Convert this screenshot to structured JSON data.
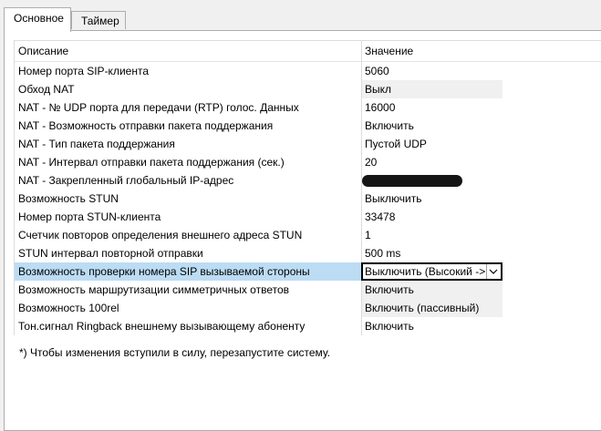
{
  "tabs": [
    {
      "label": "Основное",
      "active": true
    },
    {
      "label": "Таймер",
      "active": false
    }
  ],
  "table": {
    "header": {
      "description": "Описание",
      "value": "Значение"
    },
    "rows": [
      {
        "description": "Номер порта SIP-клиента",
        "value": "5060"
      },
      {
        "description": "Обход NAT",
        "value": "Выкл"
      },
      {
        "description": "NAT - № UDP порта для передачи (RTP) голос. Данных",
        "value": "16000"
      },
      {
        "description": "NAT - Возможность отправки пакета поддержания",
        "value": "Включить"
      },
      {
        "description": "NAT - Тип пакета поддержания",
        "value": "Пустой UDP"
      },
      {
        "description": "NAT -  Интервал отправки пакета поддержания (сек.)",
        "value": "20"
      },
      {
        "description": "NAT - Закрепленный глобальный IP-адрес",
        "value": ""
      },
      {
        "description": "Возможность STUN",
        "value": "Выключить"
      },
      {
        "description": "Номер порта STUN-клиента",
        "value": "33478"
      },
      {
        "description": "Счетчик повторов определения внешнего адреса STUN",
        "value": "1"
      },
      {
        "description": "STUN интервал повторной отправки",
        "value": "500 ms"
      },
      {
        "description": "Возможность проверки номера SIP вызываемой стороны",
        "value": "Выключить (Высокий ->Ни"
      },
      {
        "description": "Возможность маршрутизации симметричных ответов",
        "value": "Включить"
      },
      {
        "description": "Возможность 100rel",
        "value": "Включить (пассивный)"
      },
      {
        "description": "Тон.сигнал Ringback внешнему вызывающему абоненту",
        "value": "Включить"
      }
    ]
  },
  "footnote": "*) Чтобы изменения вступили в силу, перезапустите систему.",
  "colors": {
    "selection": "#bcdcf4",
    "shaded_value": "#f0f0f0"
  }
}
